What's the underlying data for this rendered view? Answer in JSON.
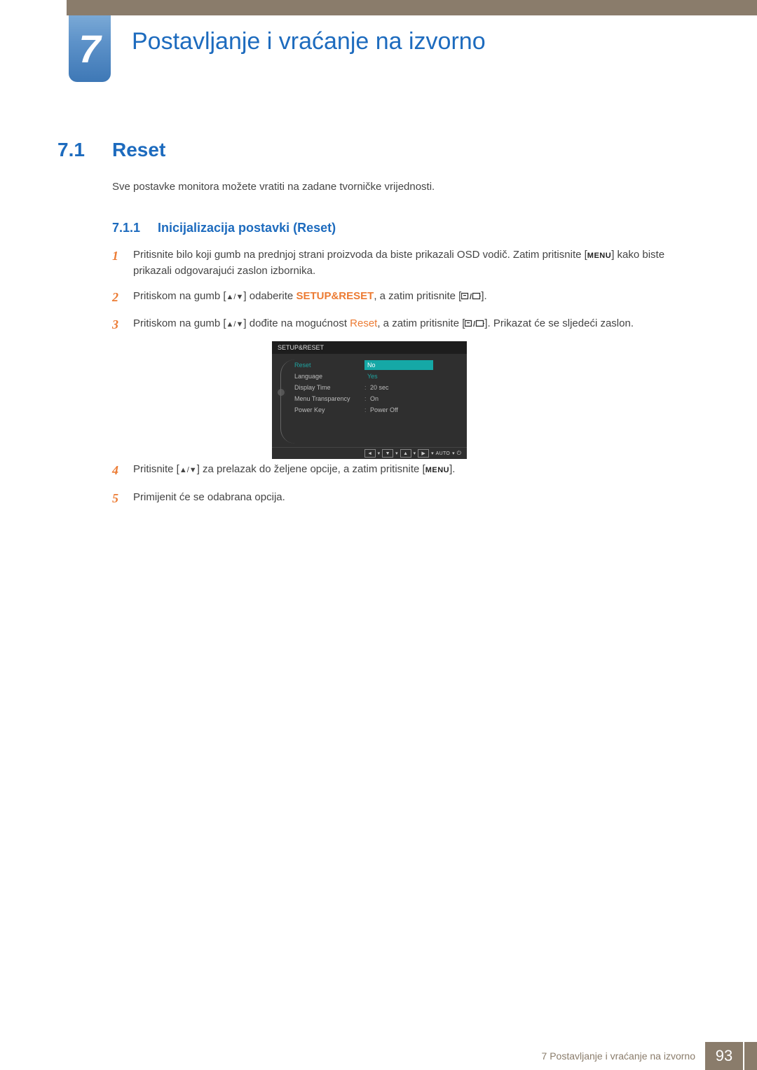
{
  "chapter": {
    "number": "7",
    "title": "Postavljanje i vraćanje na izvorno"
  },
  "section": {
    "number": "7.1",
    "title": "Reset",
    "intro": "Sve postavke monitora možete vratiti na zadane tvorničke vrijednosti."
  },
  "subsection": {
    "number": "7.1.1",
    "title": "Inicijalizacija postavki (Reset)"
  },
  "steps": {
    "s1": {
      "num": "1",
      "a": "Pritisnite bilo koji gumb na prednjoj strani proizvoda da biste prikazali OSD vodič. Zatim pritisnite [",
      "menu": "MENU",
      "b": "] kako biste prikazali odgovarajući zaslon izbornika."
    },
    "s2": {
      "num": "2",
      "a": "Pritiskom na gumb [",
      "b": "] odaberite ",
      "kw": "SETUP&RESET",
      "c": ", a zatim pritisnite [",
      "d": "]."
    },
    "s3": {
      "num": "3",
      "a": "Pritiskom na gumb [",
      "b": "] dođite na mogućnost ",
      "kw": "Reset",
      "c": ", a zatim pritisnite [",
      "d": "]. Prikazat će se sljedeći zaslon."
    },
    "s4": {
      "num": "4",
      "a": "Pritisnite [",
      "b": "] za prelazak do željene opcije, a zatim pritisnite [",
      "menu": "MENU",
      "c": "]."
    },
    "s5": {
      "num": "5",
      "a": "Primijenit će se odabrana opcija."
    }
  },
  "osd": {
    "header": "SETUP&RESET",
    "rows": {
      "reset": {
        "label": "Reset",
        "val": "No",
        "val2": "Yes"
      },
      "lang": {
        "label": "Language"
      },
      "disp": {
        "label": "Display Time",
        "val": "20 sec"
      },
      "trans": {
        "label": "Menu Transparency",
        "val": "On"
      },
      "power": {
        "label": "Power Key",
        "val": "Power Off"
      }
    },
    "footer": {
      "auto": "AUTO"
    }
  },
  "footer": {
    "text": "7 Postavljanje i vraćanje na izvorno",
    "page": "93"
  }
}
